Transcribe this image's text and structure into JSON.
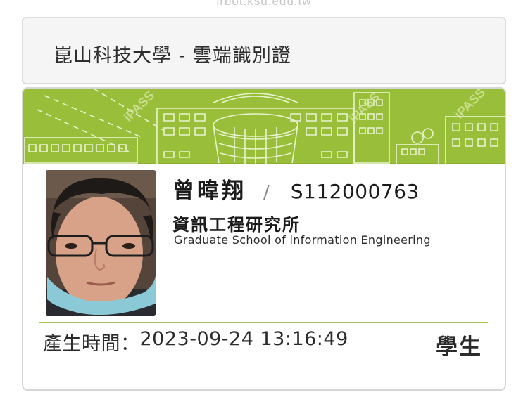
{
  "browser": {
    "url": "irbot.ksu.edu.tw"
  },
  "header": {
    "title": "崑山科技大學 - 雲端識別證"
  },
  "card": {
    "banner_watermark": "iPASS",
    "photo_alt": "Student photo",
    "name": "曾暐翔",
    "separator": "/",
    "student_id": "S112000763",
    "department_zh": "資訊工程研究所",
    "department_en": "Graduate School of information Engineering",
    "generated_label": "產生時間：",
    "generated_time": "2023-09-24 13:16:49",
    "status": "學生"
  },
  "colors": {
    "banner_green": "#99bf3a",
    "divider_green": "#a9c95c"
  }
}
